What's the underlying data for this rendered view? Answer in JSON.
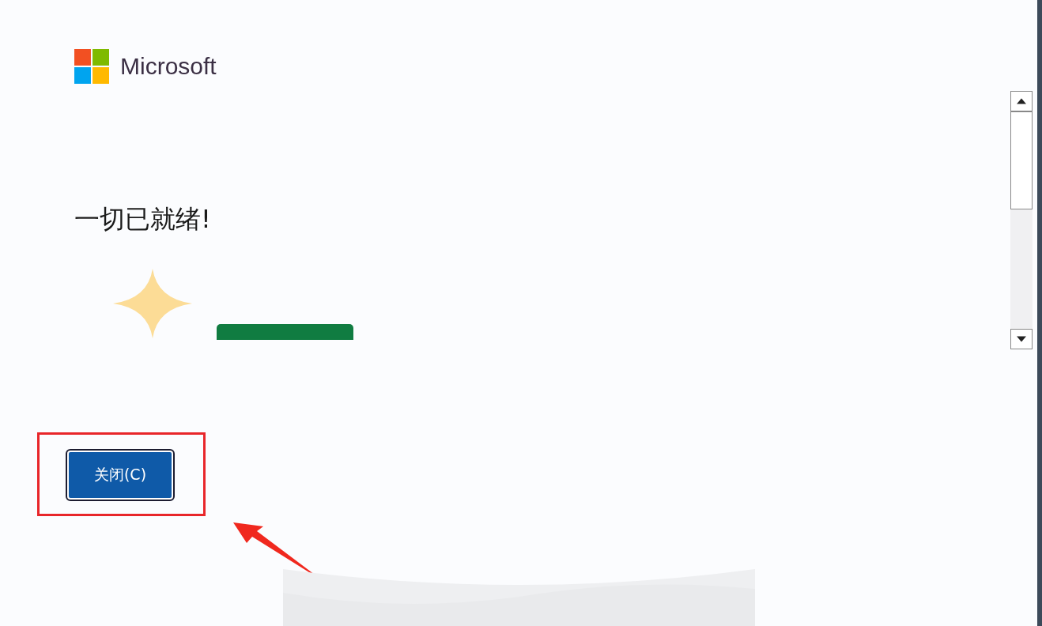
{
  "logo": {
    "text": "Microsoft"
  },
  "heading": "一切已就绪!",
  "close_button": {
    "label": "关闭(C)"
  }
}
